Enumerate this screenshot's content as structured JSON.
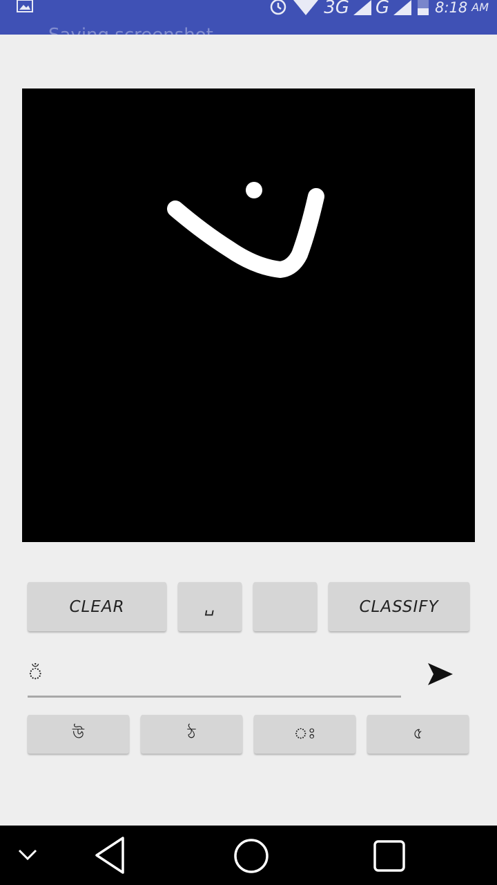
{
  "status_bar": {
    "notification_text": "Saving screenshot...",
    "network_3g": "3G",
    "network_g": "G",
    "time": "8:18",
    "ampm": "AM",
    "icons": [
      "image-icon",
      "alarm-icon",
      "wifi-icon",
      "signal-icon",
      "battery-icon"
    ]
  },
  "drawing_canvas": {
    "background": "#000000",
    "stroke_color": "#ffffff"
  },
  "buttons": {
    "clear": "CLEAR",
    "space": "␣",
    "empty": "",
    "classify": "CLASSIFY"
  },
  "text_input": {
    "value": "ঁ"
  },
  "suggestions": [
    "উ",
    "ঠ",
    "ঃ",
    "৫"
  ],
  "colors": {
    "accent": "#3f51b5",
    "button_bg": "#d6d6d6",
    "screen_bg": "#eeeeee"
  },
  "nav_bar": {
    "icons": [
      "chevron-down-icon",
      "back-icon",
      "home-icon",
      "recents-icon"
    ]
  }
}
